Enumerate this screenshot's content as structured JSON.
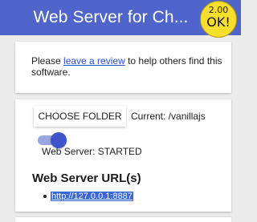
{
  "header": {
    "title": "Web Server for Ch...",
    "background": "#4f65cc",
    "badge": {
      "line1": "2.00",
      "line2": "OK!",
      "color": "#f8df2e"
    }
  },
  "review_card": {
    "prefix": "Please ",
    "link_text": "leave a review",
    "suffix": " to help others find this software."
  },
  "server_card": {
    "choose_folder_label": "CHOOSE FOLDER",
    "current_folder": "Current: /vanillajs",
    "toggle_on": true,
    "status": "Web Server: STARTED",
    "urls_heading": "Web Server URL(s)",
    "urls": [
      "http://127.0.0.1:8887"
    ]
  }
}
